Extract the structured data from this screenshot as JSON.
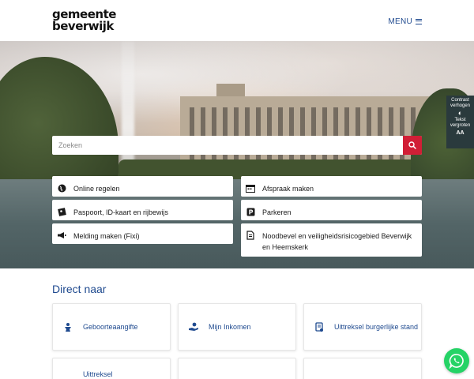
{
  "header": {
    "logo_line1": "gemeente",
    "logo_line2": "beverwijk",
    "menu_label": "MENU"
  },
  "accessibility": {
    "contrast_label": "Contrast verhogen",
    "text_label": "Tekst vergroten",
    "text_glyph": "AA"
  },
  "search": {
    "placeholder": "Zoeken",
    "value": ""
  },
  "quick_links": [
    {
      "label": "Online regelen",
      "icon": "globe-icon"
    },
    {
      "label": "Afspraak maken",
      "icon": "calendar-icon"
    },
    {
      "label": "Paspoort, ID-kaart en rijbewijs",
      "icon": "id-card-icon"
    },
    {
      "label": "Parkeren",
      "icon": "parking-icon"
    },
    {
      "label": "Melding maken (Fixi)",
      "icon": "megaphone-icon"
    },
    {
      "label": "Noodbevel en veiligheidsrisicogebied Beverwijk en Heemskerk",
      "icon": "document-icon"
    }
  ],
  "direct_naar": {
    "title": "Direct naar",
    "cards": [
      {
        "label": "Geboorteaangifte",
        "icon": "baby-icon"
      },
      {
        "label": "Mijn Inkomen",
        "icon": "hands-money-icon"
      },
      {
        "label": "Uittreksel burgerlijke stand",
        "icon": "certificate-icon"
      },
      {
        "label": "Uittreksel",
        "icon": ""
      },
      {
        "label": "",
        "icon": ""
      },
      {
        "label": "",
        "icon": ""
      }
    ]
  },
  "colors": {
    "brand_blue": "#1f4a8f",
    "search_red": "#d11f36",
    "whatsapp_green": "#25d366"
  }
}
